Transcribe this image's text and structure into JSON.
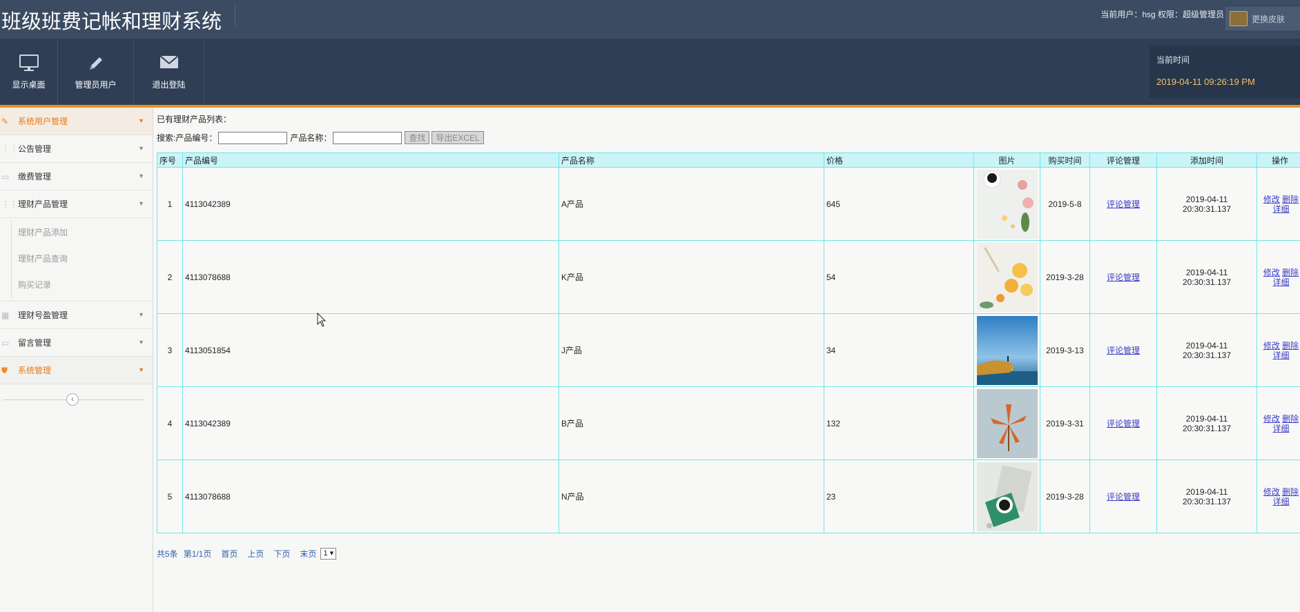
{
  "header": {
    "title": "班级班费记帐和理财系统",
    "user_info": "当前用户：hsg  权限：超级管理员",
    "skin_label": "更换皮肤"
  },
  "toolbar": {
    "items": [
      {
        "label": "显示桌面",
        "icon": "monitor-icon"
      },
      {
        "label": "管理员用户",
        "icon": "pencil-icon"
      },
      {
        "label": "退出登陆",
        "icon": "envelope-icon"
      }
    ],
    "time_label": "当前时间",
    "time_value": "2019-04-11 09:26:19 PM"
  },
  "sidebar": {
    "items": [
      {
        "label": "系统用户管理"
      },
      {
        "label": "公告管理"
      },
      {
        "label": "缴费管理"
      },
      {
        "label": "理财产品管理"
      },
      {
        "label": "理财号盈管理"
      },
      {
        "label": "留言管理"
      },
      {
        "label": "系统管理"
      }
    ],
    "subitems": [
      {
        "label": "理财产品添加"
      },
      {
        "label": "理财产品查询"
      },
      {
        "label": "购买记录"
      }
    ]
  },
  "main": {
    "caption": "已有理财产品列表：",
    "search": {
      "prefix": "搜索:",
      "code_label": "产品编号：",
      "name_label": "产品名称：",
      "code_value": "",
      "name_value": "",
      "find_button": "查找",
      "export_button": "导出EXCEL"
    },
    "table": {
      "headers": [
        "序号",
        "产品编号",
        "产品名称",
        "价格",
        "图片",
        "购买时间",
        "评论管理",
        "添加时间",
        "操作"
      ],
      "rows": [
        {
          "no": "1",
          "code": "4113042389",
          "name": "A产品",
          "price": "645",
          "buy_time": "2019-5-8",
          "comment": "评论管理",
          "add_date": "2019-04-11",
          "add_time": "20:30:31.137",
          "op_edit": "修改",
          "op_delete": "删除",
          "op_detail": "详细"
        },
        {
          "no": "2",
          "code": "4113078688",
          "name": "K产品",
          "price": "54",
          "buy_time": "2019-3-28",
          "comment": "评论管理",
          "add_date": "2019-04-11",
          "add_time": "20:30:31.137",
          "op_edit": "修改",
          "op_delete": "删除",
          "op_detail": "详细"
        },
        {
          "no": "3",
          "code": "4113051854",
          "name": "J产品",
          "price": "34",
          "buy_time": "2019-3-13",
          "comment": "评论管理",
          "add_date": "2019-04-11",
          "add_time": "20:30:31.137",
          "op_edit": "修改",
          "op_delete": "删除",
          "op_detail": "详细"
        },
        {
          "no": "4",
          "code": "4113042389",
          "name": "B产品",
          "price": "132",
          "buy_time": "2019-3-31",
          "comment": "评论管理",
          "add_date": "2019-04-11",
          "add_time": "20:30:31.137",
          "op_edit": "修改",
          "op_delete": "删除",
          "op_detail": "详细"
        },
        {
          "no": "5",
          "code": "4113078688",
          "name": "N产品",
          "price": "23",
          "buy_time": "2019-3-28",
          "comment": "评论管理",
          "add_date": "2019-04-11",
          "add_time": "20:30:31.137",
          "op_edit": "修改",
          "op_delete": "删除",
          "op_detail": "详细"
        }
      ]
    },
    "pager": {
      "total": "共5条",
      "page": "第1/1页",
      "first": "首页",
      "prev": "上页",
      "next": "下页",
      "last": "末页",
      "select_value": "1 ▾"
    }
  },
  "colors": {
    "header_bg": "#3b4b62",
    "toolbar_bg": "#2f3e55",
    "accent_orange": "#f0901f",
    "table_border": "#6fe4ea",
    "table_header_bg": "#c9f5f8",
    "link": "#3b3bc4"
  }
}
